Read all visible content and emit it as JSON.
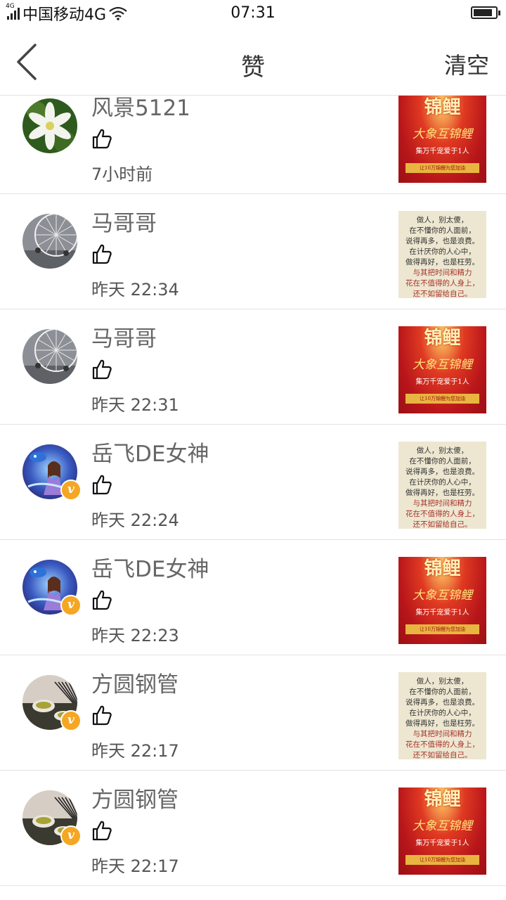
{
  "status_bar": {
    "network_tag": "4G",
    "carrier": "中国移动4G",
    "time": "07:31"
  },
  "header": {
    "title": "赞",
    "clear_label": "清空"
  },
  "thumbnails": {
    "red_card": {
      "line1": "锦鲤",
      "line2": "大象互锦鲤",
      "line3": "集万千宠爱于1人",
      "line4": "让10万锦鲤为您加油",
      "color": "#b8161a"
    },
    "paper_card": {
      "lines_black": [
        "做人，别太傻，",
        "在不懂你的人面前，",
        "说得再多，也是浪费。",
        "在计厌你的人心中，",
        "做得再好，也是枉劳。"
      ],
      "lines_red": [
        "与其把时间和精力",
        "花在不值得的人身上，",
        "还不如留给自己。"
      ],
      "color": "#ede7d1"
    }
  },
  "likes": [
    {
      "name": "风景5121",
      "time": "7小时前",
      "avatar": "flower",
      "verified": false,
      "thumb": "red_card"
    },
    {
      "name": "马哥哥",
      "time": "昨天 22:34",
      "avatar": "ferris",
      "verified": false,
      "thumb": "paper_card"
    },
    {
      "name": "马哥哥",
      "time": "昨天 22:31",
      "avatar": "ferris",
      "verified": false,
      "thumb": "red_card"
    },
    {
      "name": "岳飞DE女神",
      "time": "昨天 22:24",
      "avatar": "fantasy",
      "verified": true,
      "thumb": "paper_card"
    },
    {
      "name": "岳飞DE女神",
      "time": "昨天 22:23",
      "avatar": "fantasy",
      "verified": true,
      "thumb": "red_card"
    },
    {
      "name": "方圆钢管",
      "time": "昨天 22:17",
      "avatar": "tea",
      "verified": true,
      "thumb": "paper_card"
    },
    {
      "name": "方圆钢管",
      "time": "昨天 22:17",
      "avatar": "tea",
      "verified": true,
      "thumb": "red_card"
    }
  ],
  "icons": {
    "back": "back-arrow-icon",
    "like": "thumbs-up-icon",
    "verified": "verified-v-badge-icon",
    "accent": "#f5a623"
  }
}
